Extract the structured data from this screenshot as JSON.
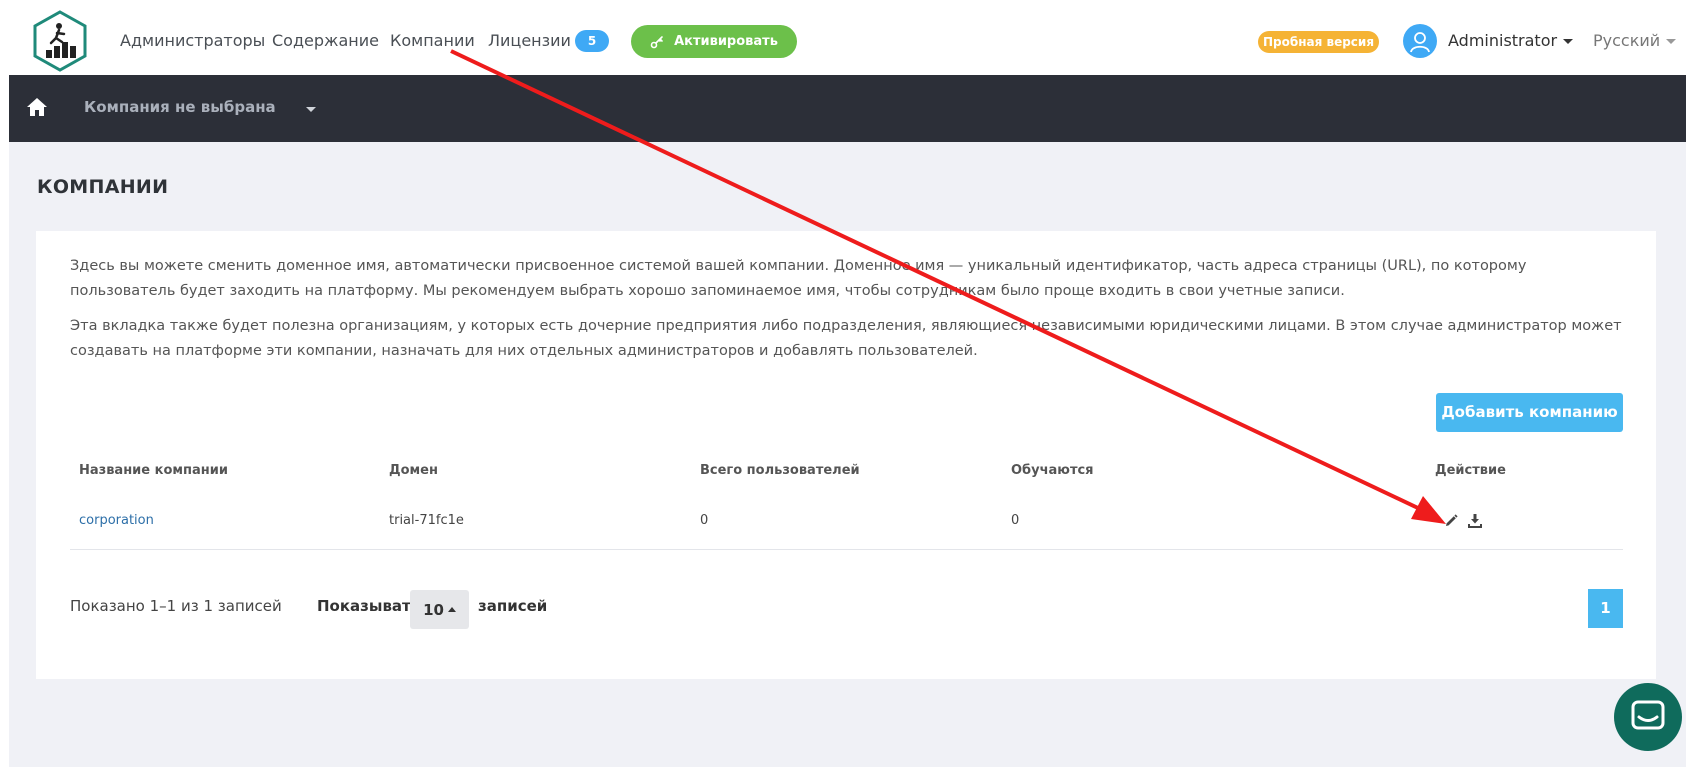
{
  "nav": {
    "items": [
      "Администраторы",
      "Содержание",
      "Компании",
      "Лицензии"
    ],
    "license_count": "5",
    "activate_label": "Активировать",
    "trial_label": "Пробная версия",
    "user_name": "Administrator",
    "language": "Русский"
  },
  "company_bar": {
    "selected": "Компания не выбрана"
  },
  "page": {
    "title": "КОМПАНИИ",
    "description_1": "Здесь вы можете сменить доменное имя, автоматически присвоенное системой вашей компании. Доменное имя — уникальный идентификатор, часть адреса страницы (URL), по которому пользователь будет заходить на платформу. Мы рекомендуем выбрать хорошо запоминаемое имя, чтобы сотрудникам было проще входить в свои учетные записи.",
    "description_2": "Эта вкладка также будет полезна организациям, у которых есть дочерние предприятия либо подразделения, являющиеся независимыми юридическими лицами. В этом случае администратор может создавать на платформе эти компании, назначать для них отдельных администраторов и добавлять пользователей.",
    "add_button": "Добавить компанию"
  },
  "table": {
    "headers": [
      "Название компании",
      "Домен",
      "Всего пользователей",
      "Обучаются",
      "Действие"
    ],
    "rows": [
      {
        "name": "corporation",
        "domain": "trial-71fc1e",
        "total_users": "0",
        "learning": "0"
      }
    ]
  },
  "pagination": {
    "shown_text": "Показано 1–1 из 1 записей",
    "show_label": "Показывать",
    "per_page": "10",
    "records_label": "записей",
    "current_page": "1"
  },
  "colors": {
    "accent_blue": "#49b8f0",
    "activate_green": "#6cc04a",
    "trial_orange": "#f5b335",
    "dark_bar": "#2c2f38",
    "annotation_red": "#ee1c1c",
    "chat_teal": "#0f6b5c"
  },
  "icons": [
    "logo-icon",
    "key-icon",
    "user-avatar-icon",
    "home-icon",
    "pencil-icon",
    "download-icon",
    "chat-icon"
  ]
}
